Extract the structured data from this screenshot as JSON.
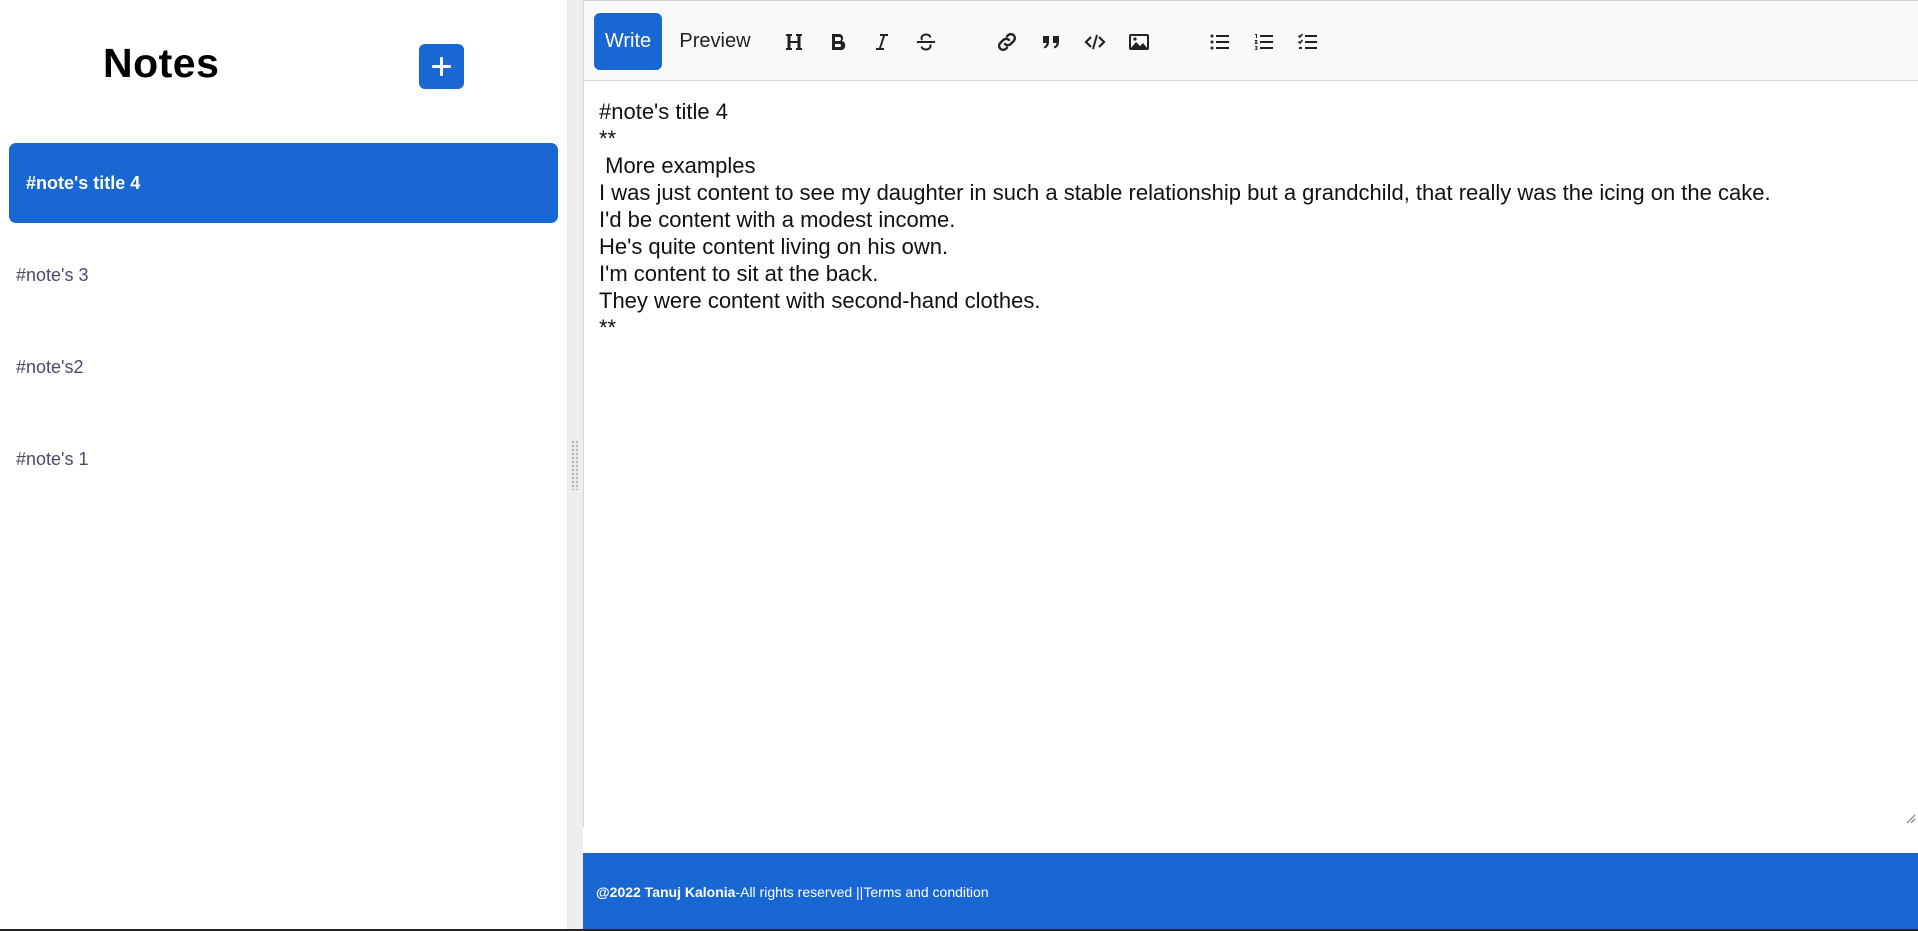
{
  "sidebar": {
    "title": "Notes",
    "add_button_icon": "plus-icon",
    "notes": [
      {
        "label": "#note's title 4",
        "active": true
      },
      {
        "label": "#note's 3",
        "active": false
      },
      {
        "label": "#note's2",
        "active": false
      },
      {
        "label": "#note's 1",
        "active": false
      }
    ]
  },
  "editor": {
    "tabs": {
      "write": "Write",
      "preview": "Preview"
    },
    "active_tab": "Write",
    "toolbar_icons": [
      "heading-icon",
      "bold-icon",
      "italic-icon",
      "strikethrough-icon",
      "link-icon",
      "quote-icon",
      "code-icon",
      "image-icon",
      "unordered-list-icon",
      "ordered-list-icon",
      "checklist-icon"
    ],
    "content": "#note's title 4\n**\n More examples\nI was just content to see my daughter in such a stable relationship but a grandchild, that really was the icing on the cake.\nI'd be content with a modest income.\nHe's quite content living on his own.\nI'm content to sit at the back.\nThey were content with second-hand clothes.\n**"
  },
  "footer": {
    "author": "@2022 Tanuj Kalonia",
    "rights": " -All rights reserved || ",
    "terms": "Terms and condition"
  },
  "colors": {
    "accent": "#1967d2",
    "splitter": "#eeeeee",
    "toolbar_bg": "#f9f9f9"
  }
}
